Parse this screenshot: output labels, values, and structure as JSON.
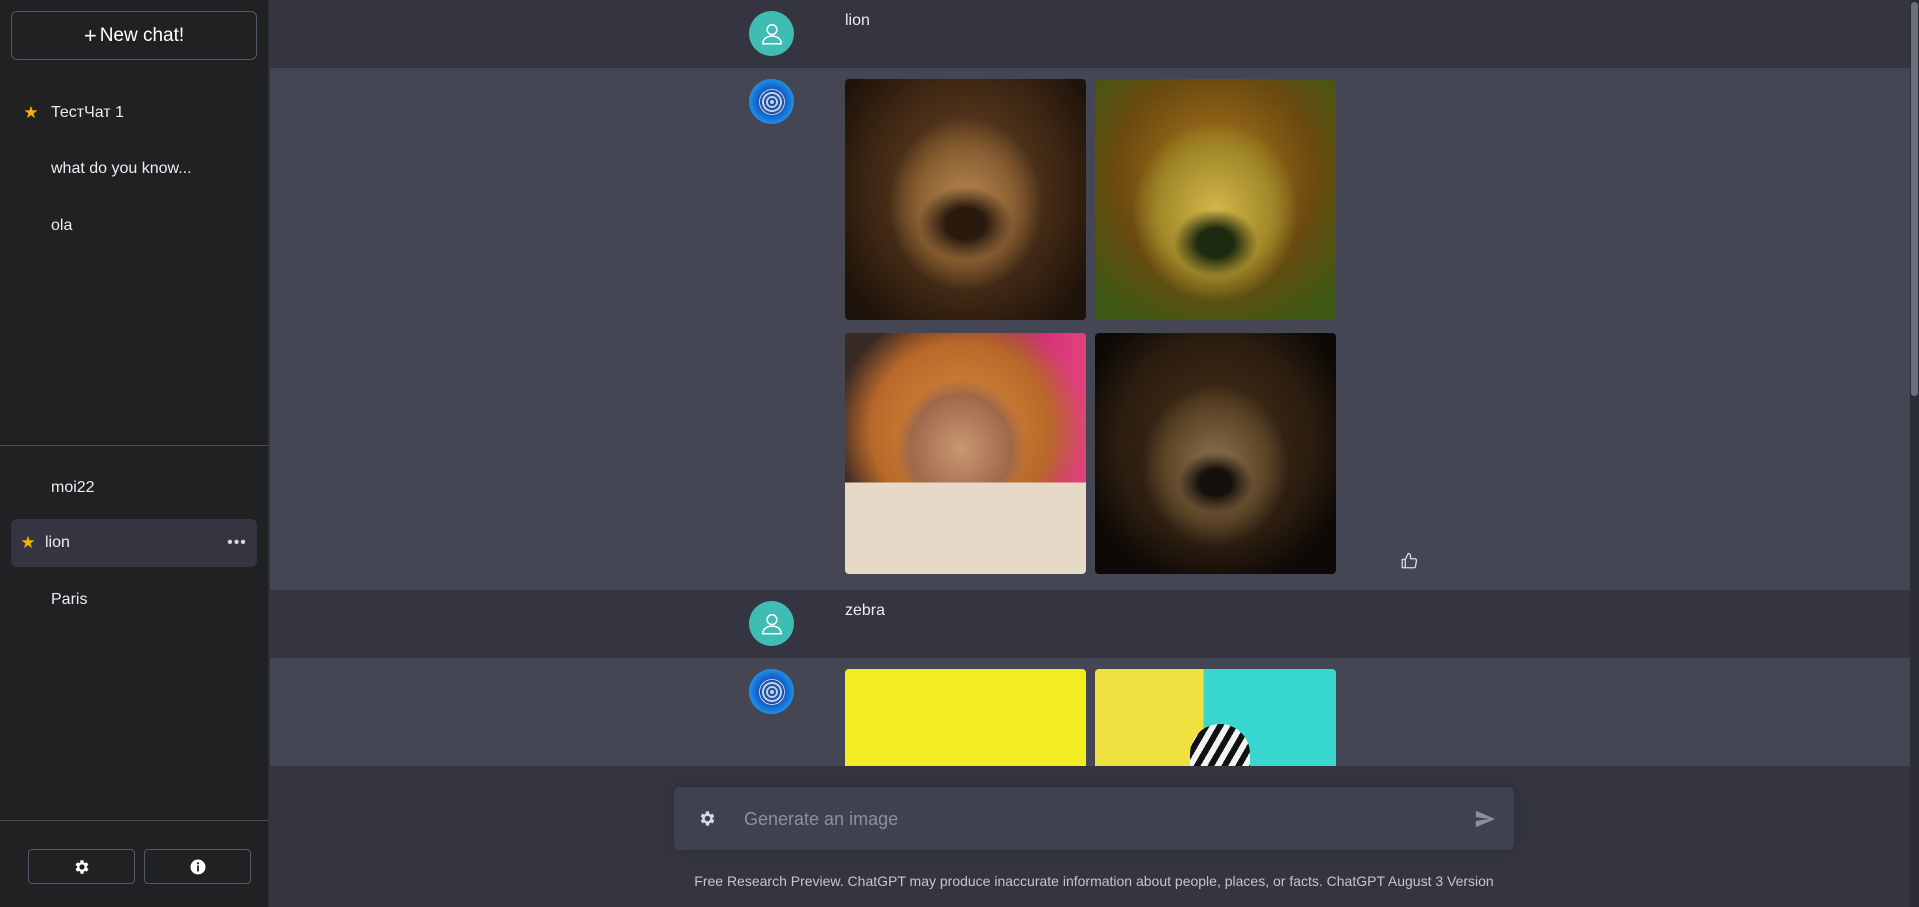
{
  "sidebar": {
    "new_chat_label": "New chat!",
    "chats_top": [
      {
        "label": "ТестЧат 1",
        "starred": true
      },
      {
        "label": "what do you know...",
        "starred": false
      },
      {
        "label": "ola",
        "starred": false
      }
    ],
    "chats_bottom": [
      {
        "label": "moi22",
        "starred": false
      },
      {
        "label": "lion",
        "starred": true,
        "active": true
      },
      {
        "label": "Paris",
        "starred": false
      }
    ],
    "settings_icon": "gear-icon",
    "info_icon": "info-icon"
  },
  "conversation": {
    "messages": [
      {
        "role": "user",
        "text": "lion"
      },
      {
        "role": "bot",
        "images": [
          "lion-image-1",
          "lion-image-2",
          "lion-image-3",
          "lion-image-4"
        ]
      },
      {
        "role": "user",
        "text": "zebra"
      },
      {
        "role": "bot",
        "images": [
          "zebra-image-1",
          "zebra-image-2"
        ]
      }
    ]
  },
  "composer": {
    "placeholder": "Generate an image"
  },
  "footer": {
    "text": "Free Research Preview. ChatGPT may produce inaccurate information about people, places, or facts. ChatGPT August 3 Version"
  },
  "colors": {
    "sidebar_bg": "#202123",
    "main_bg": "#343541",
    "bot_row_bg": "#444654",
    "user_avatar": "#3fbdb3",
    "star": "#f4b400"
  }
}
